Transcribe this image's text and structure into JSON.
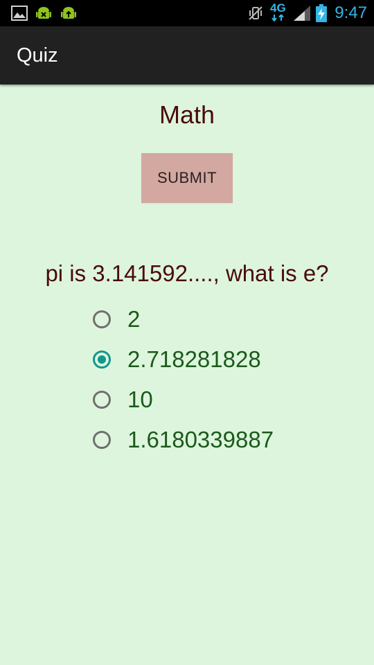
{
  "status_bar": {
    "time": "9:47",
    "time_color": "#33b5e5",
    "left_icons": [
      "image-icon",
      "android-debug-icon",
      "android-usb-icon"
    ],
    "right_icons": [
      "vibrate-mute-icon",
      "network-4g-lte-icon",
      "signal-icon",
      "battery-charging-icon"
    ],
    "network_label": "4G"
  },
  "action_bar": {
    "title": "Quiz"
  },
  "quiz": {
    "subject": "Math",
    "submit_label": "SUBMIT",
    "question": "pi is 3.141592...., what is e?",
    "options": [
      {
        "label": "2",
        "checked": false
      },
      {
        "label": "2.718281828",
        "checked": true
      },
      {
        "label": "10",
        "checked": false
      },
      {
        "label": "1.6180339887",
        "checked": false
      }
    ]
  },
  "colors": {
    "background": "#ddf5dd",
    "action_bar": "#212121",
    "submit_bg": "#d2a8a0",
    "title_text": "#4a0a0a",
    "option_text": "#1a5a1a",
    "radio_accent": "#13968e"
  }
}
